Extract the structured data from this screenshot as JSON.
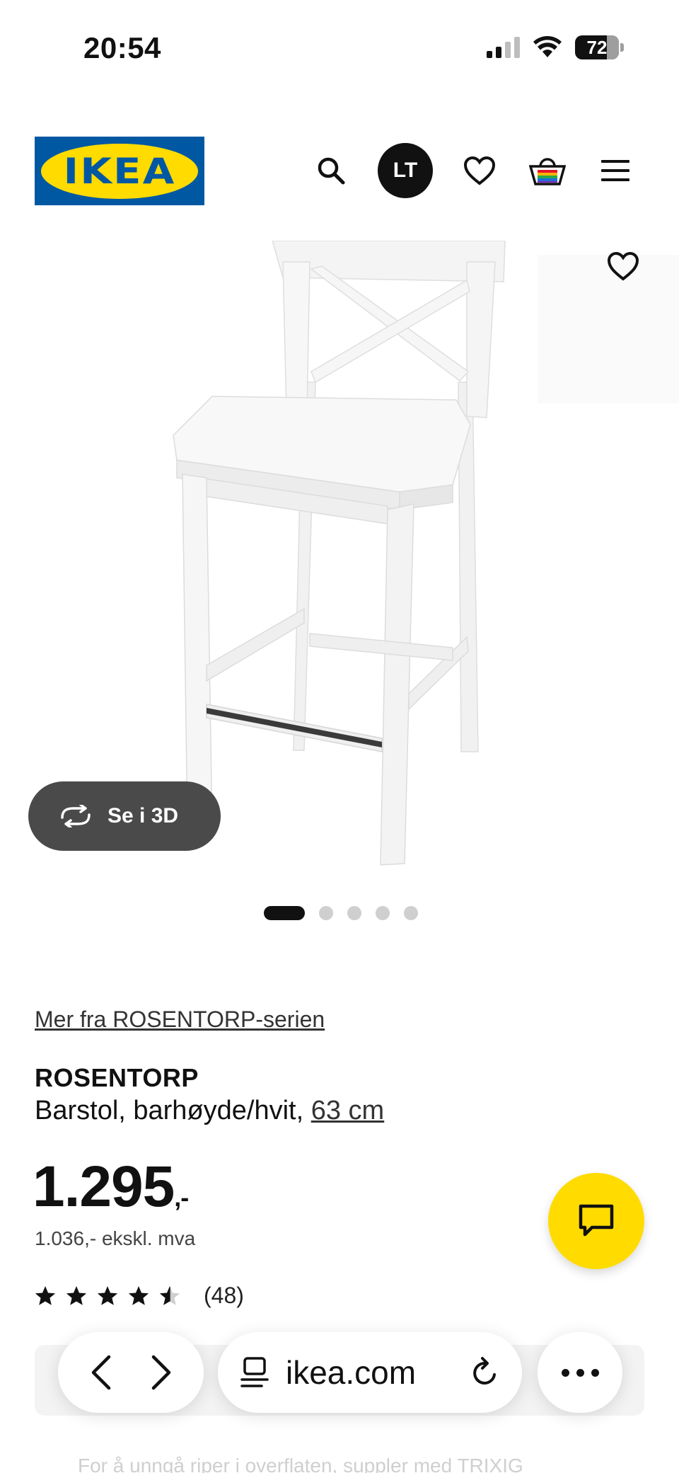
{
  "status_bar": {
    "time": "20:54",
    "battery": "72",
    "battery_level_percent": 72
  },
  "header": {
    "logo_text": "IKEA",
    "avatar_initials": "LT",
    "icons": [
      "search-icon",
      "heart-icon",
      "shopping-bag-icon",
      "menu-icon"
    ]
  },
  "gallery": {
    "see_3d_label": "Se i 3D",
    "image_count": 5,
    "active_index": 0
  },
  "product": {
    "series_link": "Mer fra ROSENTORP-serien",
    "name": "ROSENTORP",
    "description": "Barstol, barhøyde/hvit,",
    "size": "63 cm",
    "price": "1.295",
    "price_suffix": ",-",
    "price_ex_vat": "1.036,- ekskl. mva",
    "rating_value": 4.5,
    "rating_count": "(48)"
  },
  "footer_hint": {
    "text": "For å unngå riper i overflaten, suppler med TRIXIG"
  },
  "browser": {
    "url": "ikea.com"
  },
  "colors": {
    "brand_blue": "#0058A3",
    "brand_yellow": "#FFDB00"
  }
}
